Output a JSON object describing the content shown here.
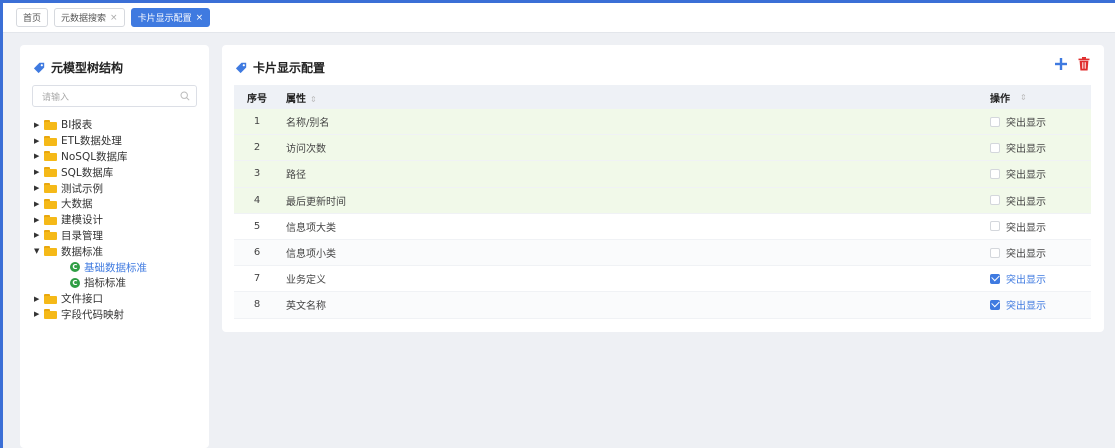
{
  "tabs": [
    {
      "label": "首页",
      "closable": false,
      "active": false
    },
    {
      "label": "元数据搜索",
      "closable": true,
      "active": false
    },
    {
      "label": "卡片显示配置",
      "closable": true,
      "active": true
    }
  ],
  "left_panel": {
    "title": "元模型树结构",
    "search_placeholder": "请输入",
    "tree": [
      {
        "label": "BI报表",
        "type": "folder",
        "expanded": false
      },
      {
        "label": "ETL数据处理",
        "type": "folder",
        "expanded": false
      },
      {
        "label": "NoSQL数据库",
        "type": "folder",
        "expanded": false
      },
      {
        "label": "SQL数据库",
        "type": "folder",
        "expanded": false
      },
      {
        "label": "测试示例",
        "type": "folder",
        "expanded": false
      },
      {
        "label": "大数据",
        "type": "folder",
        "expanded": false
      },
      {
        "label": "建模设计",
        "type": "folder",
        "expanded": false
      },
      {
        "label": "目录管理",
        "type": "folder",
        "expanded": false
      },
      {
        "label": "数据标准",
        "type": "folder",
        "expanded": true
      },
      {
        "label": "基础数据标准",
        "type": "leaf",
        "selected": true
      },
      {
        "label": "指标标准",
        "type": "leaf",
        "selected": false
      },
      {
        "label": "文件接口",
        "type": "folder",
        "expanded": false
      },
      {
        "label": "字段代码映射",
        "type": "folder",
        "expanded": false
      }
    ]
  },
  "right_panel": {
    "title": "卡片显示配置",
    "columns": {
      "index": "序号",
      "attribute": "属性",
      "operation": "操作"
    },
    "rows": [
      {
        "index": "1",
        "attribute": "名称/别名",
        "op_label": "突出显示",
        "checked": false,
        "highlight": true
      },
      {
        "index": "2",
        "attribute": "访问次数",
        "op_label": "突出显示",
        "checked": false,
        "highlight": true
      },
      {
        "index": "3",
        "attribute": "路径",
        "op_label": "突出显示",
        "checked": false,
        "highlight": true
      },
      {
        "index": "4",
        "attribute": "最后更新时间",
        "op_label": "突出显示",
        "checked": false,
        "highlight": true
      },
      {
        "index": "5",
        "attribute": "信息项大类",
        "op_label": "突出显示",
        "checked": false,
        "highlight": false
      },
      {
        "index": "6",
        "attribute": "信息项小类",
        "op_label": "突出显示",
        "checked": false,
        "highlight": false
      },
      {
        "index": "7",
        "attribute": "业务定义",
        "op_label": "突出显示",
        "checked": true,
        "highlight": false
      },
      {
        "index": "8",
        "attribute": "英文名称",
        "op_label": "突出显示",
        "checked": true,
        "highlight": false
      }
    ]
  },
  "colors": {
    "accent": "#3f7ae0",
    "delete": "#e02d2d",
    "folder": "#f5b918",
    "leaf": "#2f9e44",
    "highlight_row": "#f1f9e9"
  }
}
